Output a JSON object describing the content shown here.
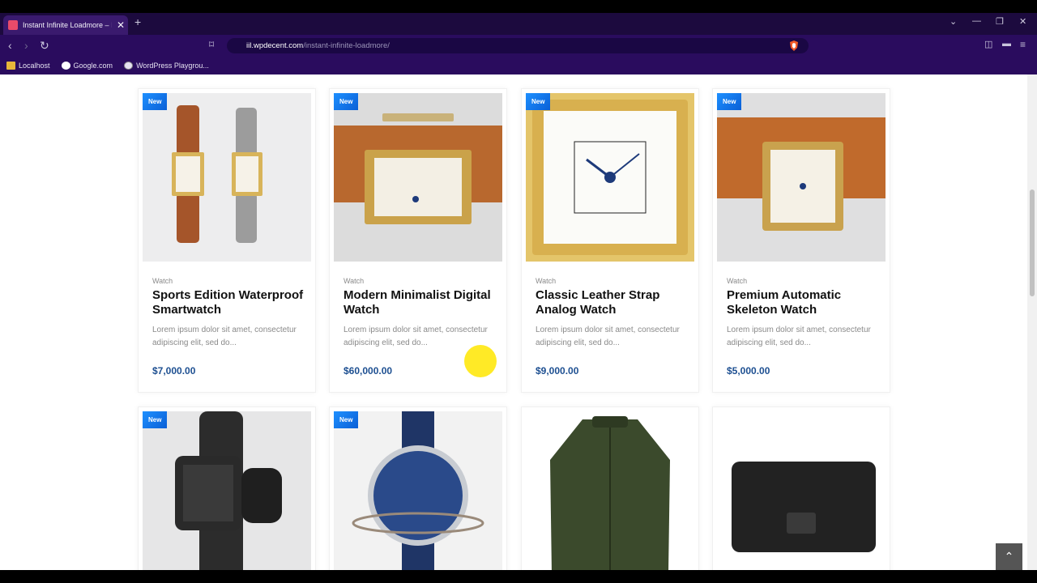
{
  "browser": {
    "tab_title": "Instant Infinite Loadmore – Inst",
    "url_domain": "iil.wpdecent.com",
    "url_path": "/instant-infinite-loadmore/",
    "bookmarks": [
      {
        "label": "Localhost",
        "icon": "folder-icon"
      },
      {
        "label": "Google.com",
        "icon": "google-icon"
      },
      {
        "label": "WordPress Playgrou...",
        "icon": "wordpress-icon"
      }
    ]
  },
  "products": [
    {
      "badge": "New",
      "category": "Watch",
      "title": "Sports Edition Waterproof Smartwatch",
      "desc": "Lorem ipsum dolor sit amet, consectetur adipiscing elit, sed do...",
      "price": "$7,000.00"
    },
    {
      "badge": "New",
      "category": "Watch",
      "title": "Modern Minimalist Digital Watch",
      "desc": "Lorem ipsum dolor sit amet, consectetur adipiscing elit, sed do...",
      "price": "$60,000.00"
    },
    {
      "badge": "New",
      "category": "Watch",
      "title": "Classic Leather Strap Analog Watch",
      "desc": "Lorem ipsum dolor sit amet, consectetur adipiscing elit, sed do...",
      "price": "$9,000.00"
    },
    {
      "badge": "New",
      "category": "Watch",
      "title": "Premium Automatic Skeleton Watch",
      "desc": "Lorem ipsum dolor sit amet, consectetur adipiscing elit, sed do...",
      "price": "$5,000.00"
    },
    {
      "badge": "New"
    },
    {
      "badge": "New"
    },
    {},
    {}
  ],
  "colors": {
    "accent": "#1d4f91",
    "badge": "#1e90ff",
    "browser_chrome": "#2a0c5e"
  }
}
